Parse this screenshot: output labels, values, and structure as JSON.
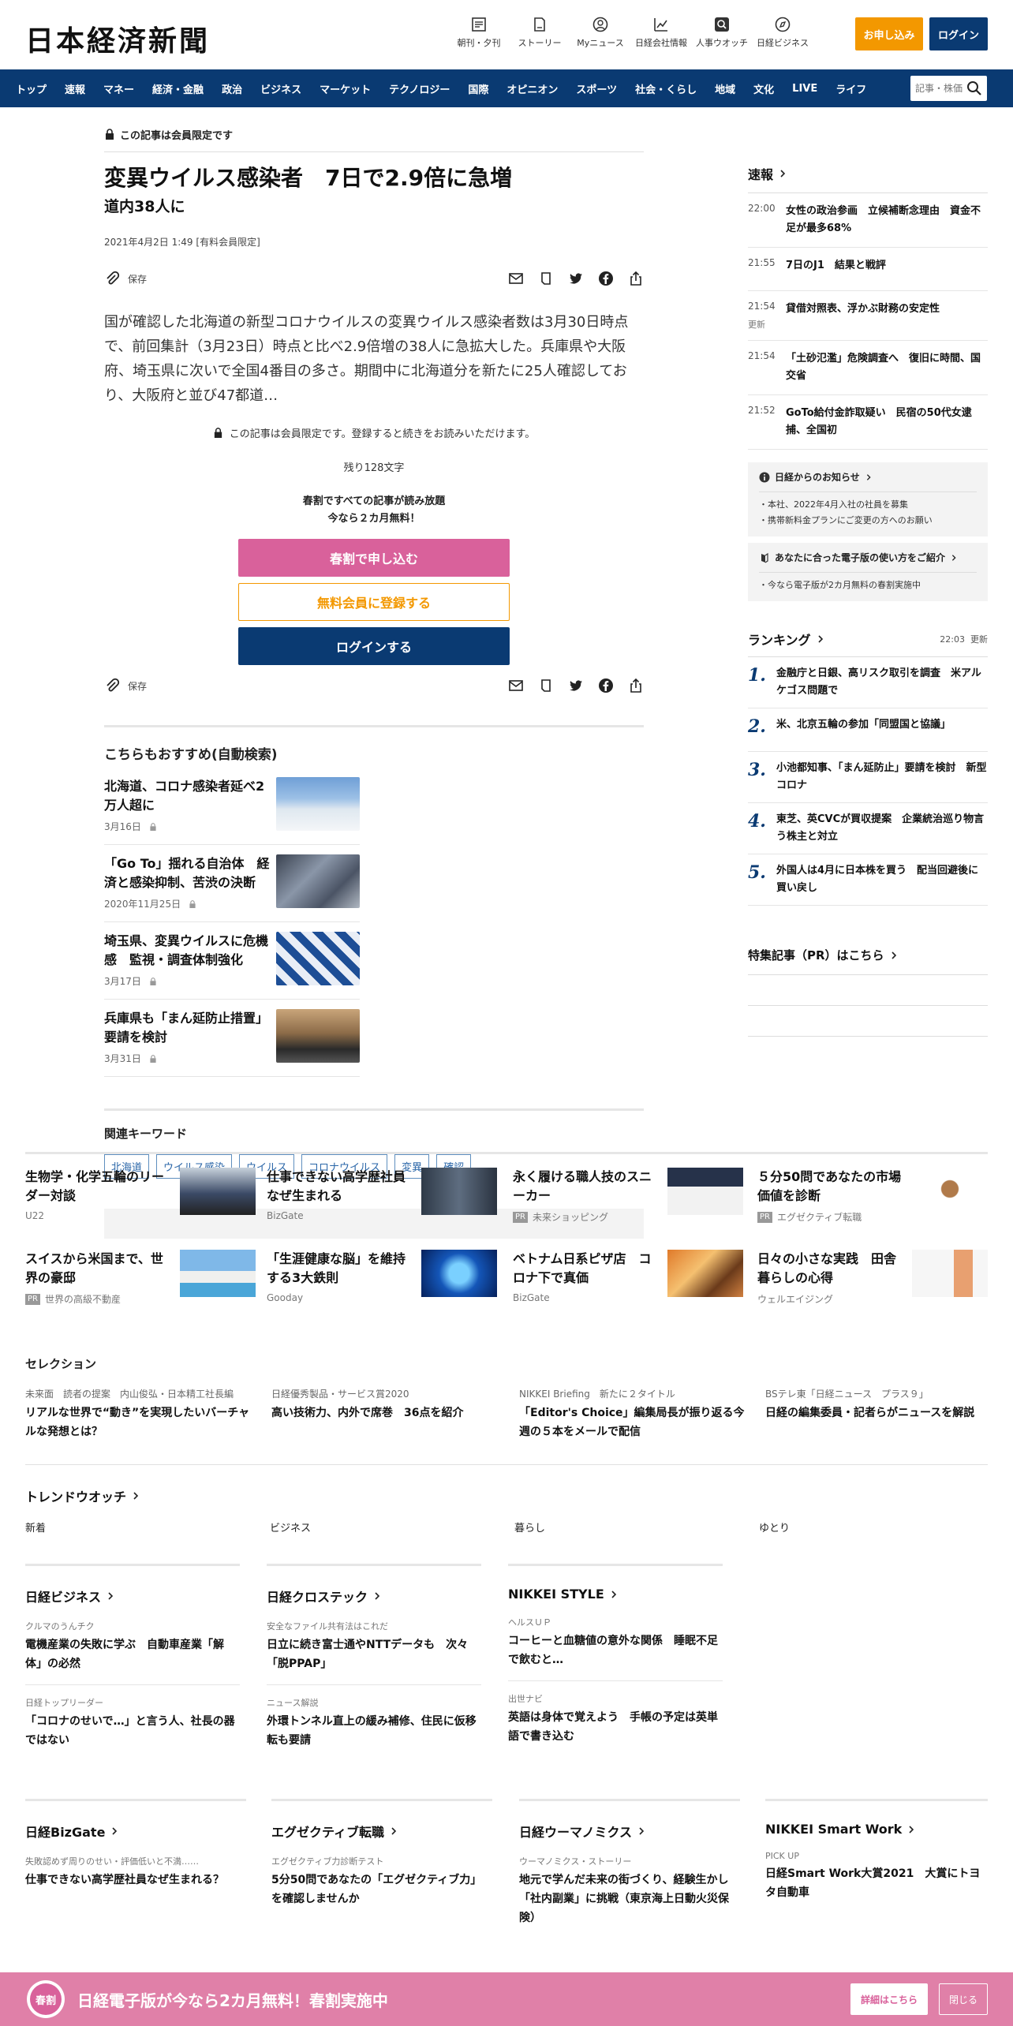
{
  "header": {
    "logo": "日本経済新聞",
    "icons": [
      {
        "label": "朝刊・夕刊",
        "icon": "newspaper-icon"
      },
      {
        "label": "ストーリー",
        "icon": "story-icon"
      },
      {
        "label": "Myニュース",
        "icon": "user-icon"
      },
      {
        "label": "日経会社情報",
        "icon": "chart-icon"
      },
      {
        "label": "人事ウオッチ",
        "icon": "search-person-icon"
      },
      {
        "label": "日経ビジネス",
        "icon": "compass-icon"
      }
    ],
    "apply_label": "お申し込み",
    "login_label": "ログイン"
  },
  "nav": {
    "items": [
      "トップ",
      "速報",
      "マネー",
      "経済・金融",
      "政治",
      "ビジネス",
      "マーケット",
      "テクノロジー",
      "国際",
      "オピニオン",
      "スポーツ",
      "社会・くらし",
      "地域",
      "文化",
      "LIVE",
      "ライフ"
    ],
    "search_placeholder": "記事・株価"
  },
  "article": {
    "members_tag": "この記事は会員限定です",
    "title": "変異ウイルス感染者　7日で2.9倍に急増",
    "subtitle": "道内38人に",
    "date": "2021年4月2日 1:49 [有料会員限定]",
    "save_label": "保存",
    "lead": "国が確認した北海道の新型コロナウイルスの変異ウイルス感染者数は3月30日時点で、前回集計（3月23日）時点と比べ2.9倍増の38人に急拡大した。兵庫県や大阪府、埼玉県に次いで全国4番目の多さ。期間中に北海道分を新たに25人確認しており、大阪府と並び47都道…",
    "notice": "この記事は会員限定です。登録すると続きをお読みいただけます。",
    "remaining": "残り128文字",
    "promo_line1": "春割ですべての記事が読み放題",
    "promo_line2": "今なら２カ月無料！",
    "btn_spring": "春割で申し込む",
    "btn_free": "無料会員に登録する",
    "btn_login": "ログインする"
  },
  "recommend": {
    "heading": "こちらもおすすめ(自動検索)",
    "items": [
      {
        "title": "北海道、コロナ感染者延べ2万人超に",
        "date": "3月16日"
      },
      {
        "title": "「Go To」揺れる自治体　経済と感染抑制、苦渋の決断",
        "date": "2020年11月25日"
      },
      {
        "title": "埼玉県、変異ウイルスに危機感　監視・調査体制強化",
        "date": "3月17日"
      },
      {
        "title": "兵庫県も「まん延防止措置」要請を検討",
        "date": "3月31日"
      }
    ]
  },
  "keywords": {
    "heading": "関連キーワード",
    "items": [
      "北海道",
      "ウイルス感染",
      "ウイルス",
      "コロナウイルス",
      "変異",
      "確認"
    ]
  },
  "sidebar": {
    "sokuho_heading": "速報",
    "sokuho": [
      {
        "time": "22:00",
        "text": "女性の政治参画　立候補断念理由　資金不足が最多68%"
      },
      {
        "time": "21:55",
        "text": "7日のJ1　結果と戦評"
      },
      {
        "time": "21:54",
        "text": "貸借対照表、浮かぶ財務の安定性",
        "extra": "更新"
      },
      {
        "time": "21:54",
        "text": "「土砂氾濫」危険調査へ　復旧に時間、国交省"
      },
      {
        "time": "21:52",
        "text": "GoTo給付金詐取疑い　民宿の50代女逮捕、全国初"
      }
    ],
    "notice_heading": "日経からのお知らせ",
    "notices": [
      "本社、2022年4月入社の社員を募集",
      "携帯新料金プランにご変更の方へのお願い"
    ],
    "guide_heading": "あなたに合った電子版の使い方をご紹介",
    "guide_item": "今なら電子版が2カ月無料の春割実施中",
    "ranking_heading": "ランキング",
    "ranking_time": "22:03",
    "ranking_update": "更新",
    "ranking": [
      {
        "n": "1.",
        "text": "金融庁と日銀、高リスク取引を調査　米アルケゴス問題で"
      },
      {
        "n": "2.",
        "text": "米、北京五輪の参加「同盟国と協議」"
      },
      {
        "n": "3.",
        "text": "小池都知事、「まん延防止」要請を検討　新型コロナ"
      },
      {
        "n": "4.",
        "text": "東芝、英CVCが買収提案　企業統治巡り物言う株主と対立"
      },
      {
        "n": "5.",
        "text": "外国人は4月に日本株を買う　配当回避後に買い戻し"
      }
    ],
    "pr_heading": "特集記事（PR）はこちら"
  },
  "ads": [
    {
      "title": "生物学・化学五輪のリーダー対談",
      "src": "U22",
      "pr": false
    },
    {
      "title": "仕事できない高学歴社員なぜ生まれる",
      "src": "BizGate",
      "pr": false
    },
    {
      "title": "永く履ける職人技のスニーカー",
      "src": "未来ショッピング",
      "pr": true
    },
    {
      "title": "５分50問であなたの市場価値を診断",
      "src": "エグゼクティブ転職",
      "pr": true
    },
    {
      "title": "スイスから米国まで、世界の豪邸",
      "src": "世界の高級不動産",
      "pr": true
    },
    {
      "title": "「生涯健康な脳」を維持する3大鉄則",
      "src": "Gooday",
      "pr": false
    },
    {
      "title": "ベトナム日系ピザ店　コロナ下で真価",
      "src": "BizGate",
      "pr": false
    },
    {
      "title": "日々の小さな実践　田舎暮らしの心得",
      "src": "ウェルエイジング",
      "pr": false
    }
  ],
  "pr_label": "PR",
  "selection": {
    "heading": "セレクション",
    "items": [
      {
        "label": "未来面　読者の提案　内山俊弘・日本精工社長編",
        "title": "リアルな世界で“動き”を実現したいバーチャルな発想とは？"
      },
      {
        "label": "日経優秀製品・サービス賞2020",
        "title": "高い技術力、内外で席巻　36点を紹介"
      },
      {
        "label": "NIKKEI Briefing　新たに２タイトル",
        "title": "「Editor's Choice」編集局長が振り返る今週の５本をメールで配信"
      },
      {
        "label": "BSテレ東「日経ニュース　プラス９」",
        "title": "日経の編集委員・記者らがニュースを解説"
      }
    ]
  },
  "trend": {
    "heading": "トレンドウオッチ",
    "tabs": [
      "新着",
      "ビジネス",
      "暮らし",
      "ゆとり"
    ]
  },
  "groups1": [
    {
      "heading": "日経ビジネス",
      "items": [
        {
          "k": "クルマのうんチク",
          "t": "電機産業の失敗に学ぶ　自動車産業「解体」の必然"
        },
        {
          "k": "日経トップリーダー",
          "t": "「コロナのせいで…」と言う人、社長の器ではない"
        }
      ]
    },
    {
      "heading": "日経クロステック",
      "items": [
        {
          "k": "安全なファイル共有法はこれだ",
          "t": "日立に続き富士通やNTTデータも　次々「脱PPAP」"
        },
        {
          "k": "ニュース解説",
          "t": "外環トンネル直上の緩み補修、住民に仮移転も要請"
        }
      ]
    },
    {
      "heading": "NIKKEI STYLE",
      "items": [
        {
          "k": "ヘルスＵＰ",
          "t": "コーヒーと血糖値の意外な関係　睡眠不足で飲むと…"
        },
        {
          "k": "出世ナビ",
          "t": "英語は身体で覚えよう　手帳の予定は英単語で書き込む"
        }
      ]
    }
  ],
  "groups2": [
    {
      "heading": "日経BizGate",
      "k": "失敗認めず周りのせい・評価低いと不満……",
      "t": "仕事できない高学歴社員なぜ生まれる？"
    },
    {
      "heading": "エグゼクティブ転職",
      "k": "エグゼクティブ力診断テスト",
      "t": "5分50問であなたの「エグゼクティブ力」を確認しませんか"
    },
    {
      "heading": "日経ウーマノミクス",
      "k": "ウーマノミクス・ストーリー",
      "t": "地元で学んだ未来の街づくり、経験生かし「社内副業」に挑戦（東京海上日動火災保険）"
    },
    {
      "heading": "NIKKEI Smart Work",
      "k": "PICK UP",
      "t": "日経Smart Work大賞2021　大賞にトヨタ自動車"
    }
  ],
  "banner": {
    "badge": "春割",
    "text": "日経電子版が今なら2カ月無料！春割実施中",
    "detail_label": "詳細はこちら",
    "close_label": "閉じる"
  },
  "colors": {
    "navy": "#0a3a72",
    "orange": "#f39800",
    "pink": "#d9619b",
    "banner": "#e080a8"
  }
}
